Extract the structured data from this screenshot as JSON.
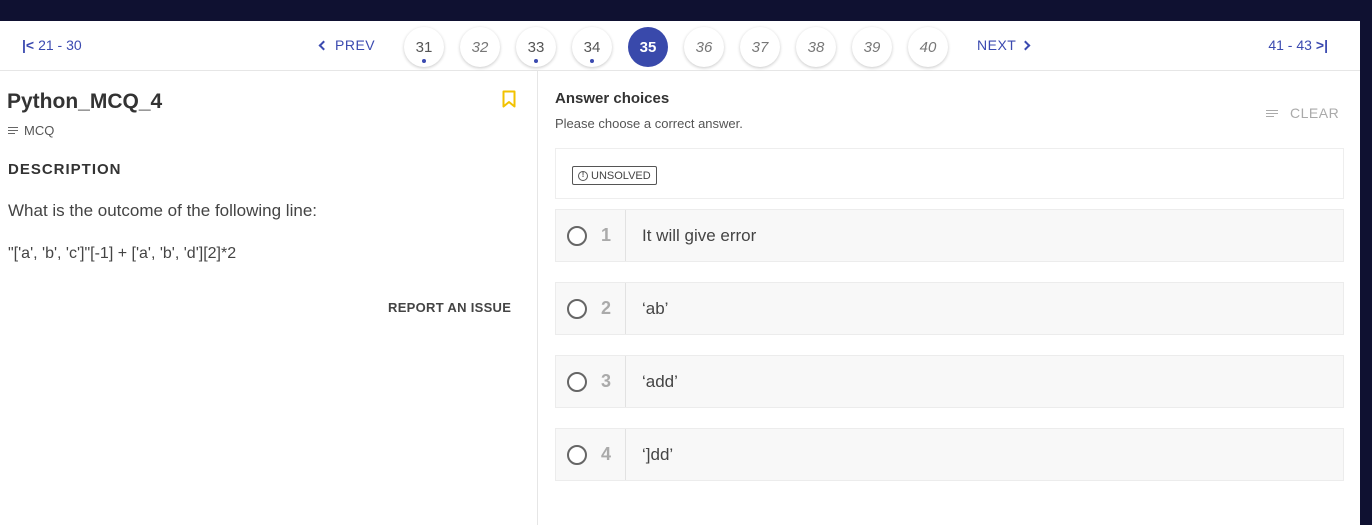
{
  "nav": {
    "prev_range": "21 - 30",
    "prev_label": "PREV",
    "next_label": "NEXT",
    "next_range": "41 - 43",
    "questions": [
      {
        "num": "31",
        "state": "visited"
      },
      {
        "num": "32",
        "state": "unvisited"
      },
      {
        "num": "33",
        "state": "visited"
      },
      {
        "num": "34",
        "state": "visited"
      },
      {
        "num": "35",
        "state": "current"
      },
      {
        "num": "36",
        "state": "unvisited"
      },
      {
        "num": "37",
        "state": "unvisited"
      },
      {
        "num": "38",
        "state": "unvisited"
      },
      {
        "num": "39",
        "state": "unvisited"
      },
      {
        "num": "40",
        "state": "unvisited"
      }
    ]
  },
  "question": {
    "title": "Python_MCQ_4",
    "type": "MCQ",
    "description_heading": "DESCRIPTION",
    "description_line1": "What is the outcome of the following line:",
    "description_line2": "\"['a', 'b', 'c']\"[-1] + ['a', 'b', 'd'][2]*2",
    "report_label": "REPORT AN ISSUE"
  },
  "answers": {
    "title": "Answer choices",
    "subtitle": "Please choose a correct answer.",
    "clear_label": "CLEAR",
    "status": "UNSOLVED",
    "options": [
      {
        "num": "1",
        "text": "It will give error"
      },
      {
        "num": "2",
        "text": "‘ab’"
      },
      {
        "num": "3",
        "text": "‘add’"
      },
      {
        "num": "4",
        "text": "‘]dd’"
      }
    ]
  },
  "colors": {
    "topbar": "#0f1131",
    "accent": "#3949ab",
    "bookmark": "#f2c200"
  },
  "icons": [
    "first-page-icon",
    "chevron-left-icon",
    "chevron-right-icon",
    "last-page-icon",
    "bookmark-icon",
    "lines-icon",
    "info-icon",
    "radio-icon"
  ]
}
